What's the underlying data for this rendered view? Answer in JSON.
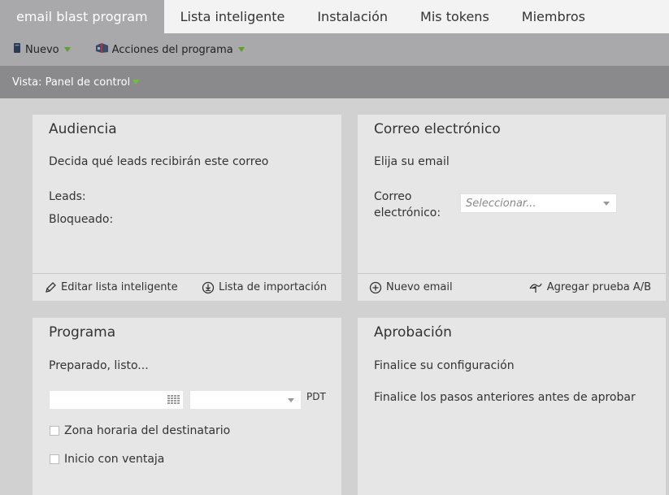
{
  "tabs": [
    {
      "label": "email blast program",
      "active": true
    },
    {
      "label": "Lista inteligente",
      "active": false
    },
    {
      "label": "Instalación",
      "active": false
    },
    {
      "label": "Mis tokens",
      "active": false
    },
    {
      "label": "Miembros",
      "active": false
    }
  ],
  "toolbar": {
    "new_label": "Nuevo",
    "actions_label": "Acciones del programa"
  },
  "view": {
    "label": "Vista: Panel de control"
  },
  "audience": {
    "title": "Audiencia",
    "description": "Decida qué leads recibirán este correo",
    "leads_label": "Leads:",
    "blocked_label": "Bloqueado:",
    "edit_list_label": "Editar lista inteligente",
    "import_list_label": "Lista de importación"
  },
  "email": {
    "title": "Correo electrónico",
    "description": "Elija su email",
    "field_label_line1": "Correo",
    "field_label_line2": "electrónico:",
    "select_placeholder": "Seleccionar...",
    "new_email_label": "Nuevo email",
    "ab_test_label": "Agregar prueba A/B"
  },
  "program": {
    "title": "Programa",
    "description": "Preparado, listo...",
    "date_value": "",
    "time_value": "",
    "timezone": "PDT",
    "recipient_tz_label": "Zona horaria del destinatario",
    "head_start_label": "Inicio con ventaja"
  },
  "approval": {
    "title": "Aprobación",
    "description": "Finalice su configuración",
    "note": "Finalice los pasos anteriores antes de aprobar"
  }
}
